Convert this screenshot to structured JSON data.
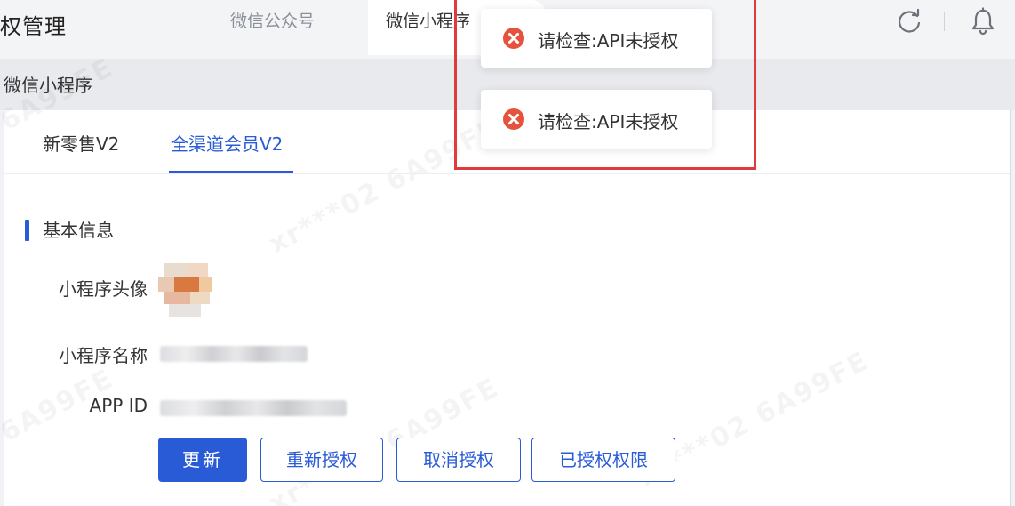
{
  "header": {
    "title": "权管理",
    "tabs": [
      {
        "label": "微信公众号"
      },
      {
        "label": "微信小程序"
      }
    ],
    "icons": {
      "refresh": "refresh-icon",
      "notification": "bell-icon"
    }
  },
  "breadcrumb": {
    "label": "微信小程序"
  },
  "inner_tabs": [
    {
      "label": "新零售V2"
    },
    {
      "label": "全渠道会员V2"
    }
  ],
  "section": {
    "title": "基本信息"
  },
  "fields": {
    "avatar_label": "小程序头像",
    "name_label": "小程序名称",
    "appid_label": "APP ID"
  },
  "buttons": {
    "update": "更新",
    "reauthorize": "重新授权",
    "cancel_auth": "取消授权",
    "authorized_perms": "已授权权限"
  },
  "toasts": [
    {
      "message": "请检查:API未授权",
      "type": "error"
    },
    {
      "message": "请检查:API未授权",
      "type": "error"
    }
  ],
  "watermark": {
    "text": "xr***02 6A99FE"
  },
  "colors": {
    "accent": "#2a5bd7",
    "error": "#e5533d",
    "highlight": "#e03a3a"
  }
}
